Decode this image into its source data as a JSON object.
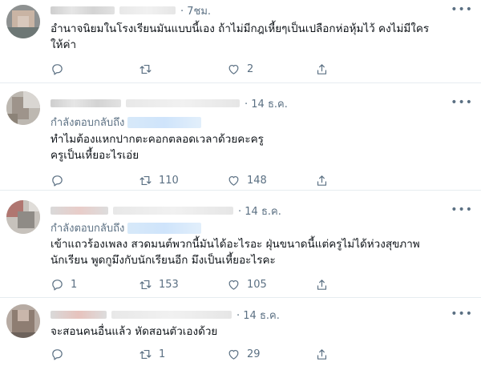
{
  "tweets": [
    {
      "time": "· 7ชม.",
      "more": "•••",
      "replying_label": "",
      "lines": [
        "อำนาจนิยมในโรงเรียนมันแบบนี้เอง ถ้าไม่มีกฎเหี้ยๆเป็นเปลือกห่อหุ้มไว้ คงไม่มีใคร",
        "ให้ค่า"
      ],
      "reply_count": "",
      "retweet_count": "",
      "like_count": "2"
    },
    {
      "time": "· 14 ธ.ค.",
      "more": "•••",
      "replying_label": "กำลังตอบกลับถึง",
      "lines": [
        "ทำไมต้องแหกปากตะคอกตลอดเวลาด้วยคะครู",
        "ครูเป็นเหี้ยอะไรเอ่ย"
      ],
      "reply_count": "",
      "retweet_count": "110",
      "like_count": "148"
    },
    {
      "time": "· 14 ธ.ค.",
      "more": "•••",
      "replying_label": "กำลังตอบกลับถึง",
      "lines": [
        "เข้าแถวร้องเพลง สวดมนต์พวกนี้มันได้อะไรอะ ฝุ่นขนาดนี้แต่ครูไม่ได้ห่วงสุขภาพ",
        "นักเรียน พูดกูมึงกับนักเรียนอีก มึงเป็นเหี้ยอะไรคะ"
      ],
      "reply_count": "1",
      "retweet_count": "153",
      "like_count": "105"
    },
    {
      "time": "· 14 ธ.ค.",
      "more": "•••",
      "replying_label": "",
      "lines": [
        "จะสอนคนอื่นแล้ว หัดสอนตัวเองด้วย"
      ],
      "reply_count": "",
      "retweet_count": "1",
      "like_count": "29"
    }
  ],
  "icons": {
    "reply": "reply-icon",
    "retweet": "retweet-icon",
    "like": "heart-icon",
    "share": "share-icon",
    "more": "more-icon"
  },
  "colors": {
    "muted": "#5b7083",
    "divider": "#e6ecf0",
    "link_blur": "#cfe4fb"
  }
}
